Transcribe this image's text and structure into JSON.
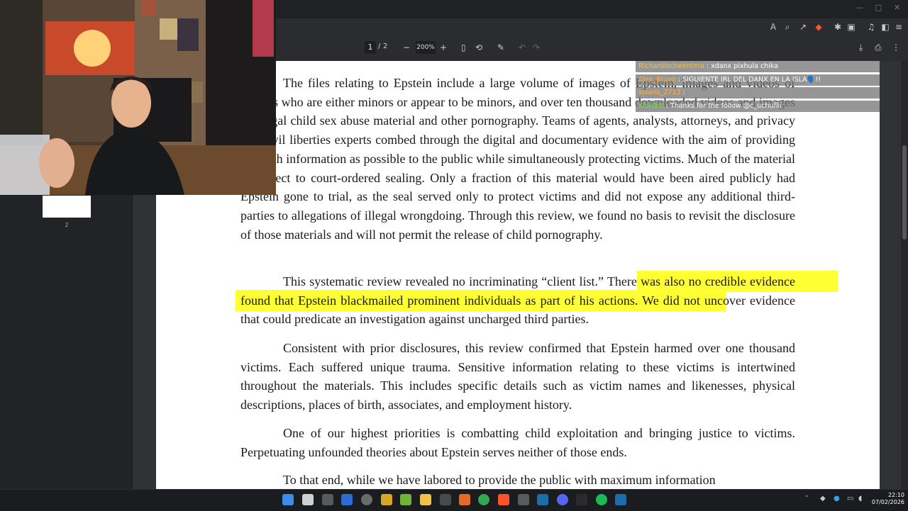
{
  "pdf_toolbar": {
    "current_page": "1",
    "page_sep": "/",
    "total_pages": "2",
    "zoom": "200%",
    "zoom_out": "−",
    "zoom_in": "+"
  },
  "sidebar": {
    "thumb_page_number": "2"
  },
  "document": {
    "p1": "The files relating to Epstein include a large volume of images of Epstein, images and videos of victims who are either minors or appear to be minors, and over ten thousand downloaded videos and images of illegal child sex abuse material and other pornography.  Teams of agents, analysts, attorneys, and privacy and civil liberties experts combed through the digital and documentary evidence with the aim of providing as much information as possible to the public while simultaneously protecting victims.  Much of the material is subject to court-ordered sealing.   Only a fraction of this material would have been aired publicly had Epstein gone to trial, as the seal served only to protect victims and did not expose any additional third-parties to allegations of illegal wrongdoing. Through this review, we found no basis to revisit the disclosure of those materials and will not permit the release of child pornography.",
    "p2_a": "This systematic review revealed no incriminating “client list.”",
    "p2_highlight": "There was also no credible evidence found that Epstein blackmailed prominent individuals as part of his actions.",
    "p2_b": "We did not uncover evidence that could predicate an investigation against uncharged third parties.",
    "p3": "Consistent with prior disclosures, this review confirmed that Epstein harmed over one thousand victims.  Each suffered unique trauma.  Sensitive information relating to these victims is intertwined throughout the materials.  This includes specific details such as victim names and likenesses, physical descriptions, places of birth, associates, and employment history.",
    "p4": "One of our highest priorities is combatting child exploitation and bringing justice to victims.  Perpetuating unfounded theories about Epstein serves neither of those ends.",
    "p5": "To that end, while we have labored to provide the public with maximum information"
  },
  "chat": [
    {
      "user": "Richardlecheentera",
      "sep": " : ",
      "message": "xdanx pixhula chika",
      "color": "#f0c040"
    },
    {
      "user": "Alex_Bravo",
      "sep": " : ",
      "message": "SIGUIENTE IRL DEL DANX EN LA ISLA🗣️!!",
      "color": "#ffb347"
    },
    {
      "user": "solaris_2713",
      "sep": " : ",
      "message": "",
      "color": "#ffb347"
    },
    {
      "user": "KickBot",
      "sep": " : ",
      "message": "Thanks for the follow @c_uchuflii",
      "color": "#53fc18"
    }
  ],
  "taskbar": {
    "time": "22:10",
    "date": "07/02/2026"
  },
  "colors": {
    "highlight": "#ffff33",
    "page_bg": "#ffffff",
    "viewer_bg": "#313236",
    "chrome_bg": "#2b2c2f"
  }
}
